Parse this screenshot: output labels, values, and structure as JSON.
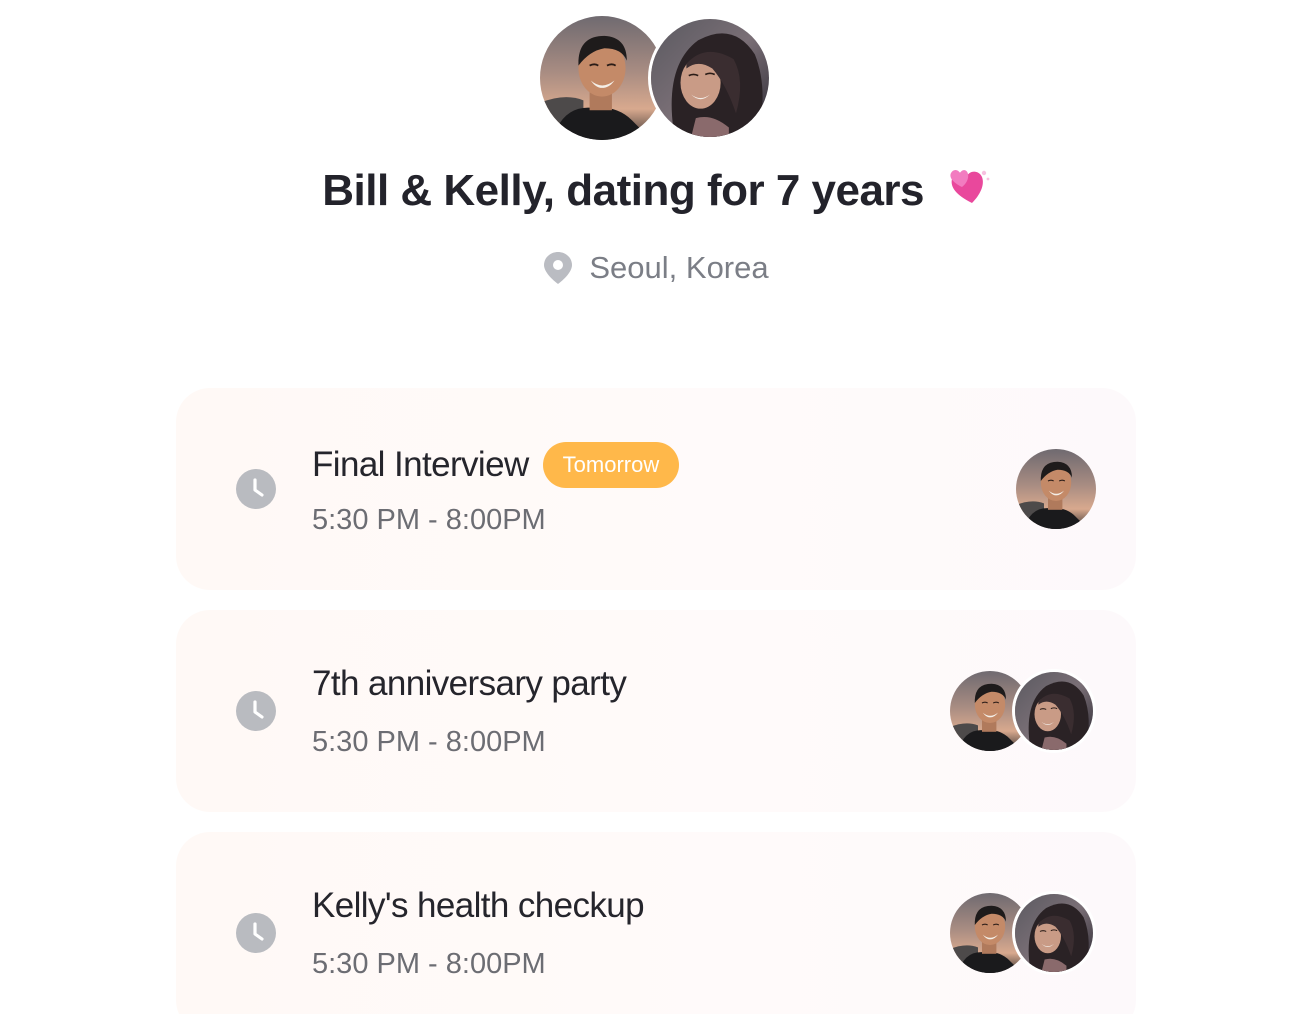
{
  "header": {
    "title": "Bill & Kelly, dating for 7 years",
    "title_emoji": "heart-emoji",
    "location": "Seoul, Korea",
    "avatars": [
      "bill-avatar",
      "kelly-avatar"
    ]
  },
  "events": [
    {
      "name": "Final Interview",
      "badge": "Tomorrow",
      "time": "5:30 PM - 8:00PM",
      "participants": [
        "bill"
      ]
    },
    {
      "name": "7th anniversary party",
      "badge": "",
      "time": "5:30 PM - 8:00PM",
      "participants": [
        "bill",
        "kelly"
      ]
    },
    {
      "name": "Kelly's health checkup",
      "badge": "",
      "time": "5:30 PM - 8:00PM",
      "participants": [
        "bill",
        "kelly"
      ]
    }
  ],
  "colors": {
    "badge": "#ffb84a",
    "title": "#23232b",
    "muted": "#7b7e86",
    "clock": "#b9bbc0",
    "card_bg": "#fff9f7"
  },
  "icons": {
    "location": "location-pin-icon",
    "time": "clock-icon"
  }
}
